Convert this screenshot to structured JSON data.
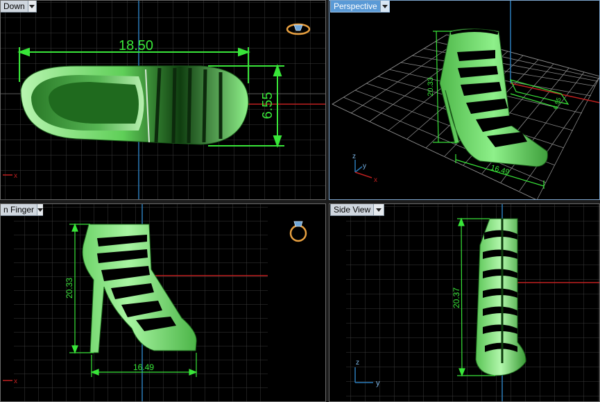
{
  "viewports": {
    "top": {
      "tab_label": "Down",
      "dimension_length": "18.50",
      "dimension_width": "6.55",
      "axis_x": "x"
    },
    "perspective": {
      "tab_label": "Perspective",
      "dimension_height": "20.33",
      "dimension_length": "16.49",
      "dimension_small": "6.55",
      "axis_z": "z",
      "axis_y": "y",
      "axis_x": "x"
    },
    "front": {
      "tab_label": "n Finger",
      "dimension_height": "20.33",
      "dimension_length": "16.49",
      "axis_x": "x"
    },
    "side": {
      "tab_label": "Side View",
      "dimension_height": "20.37",
      "axis_z": "z",
      "axis_y": "y"
    }
  },
  "colors": {
    "dimension": "#39e639",
    "model": "#8ee88a",
    "grid": "#3a3a3a",
    "grid_major": "#5c5c5c",
    "axis_red": "#c02020",
    "axis_blue": "#2a7ab8",
    "gizmo": "#e8a040"
  },
  "icons": [
    "ring-gizmo-icon",
    "dropdown-arrow-icon",
    "axis-triad-icon"
  ]
}
